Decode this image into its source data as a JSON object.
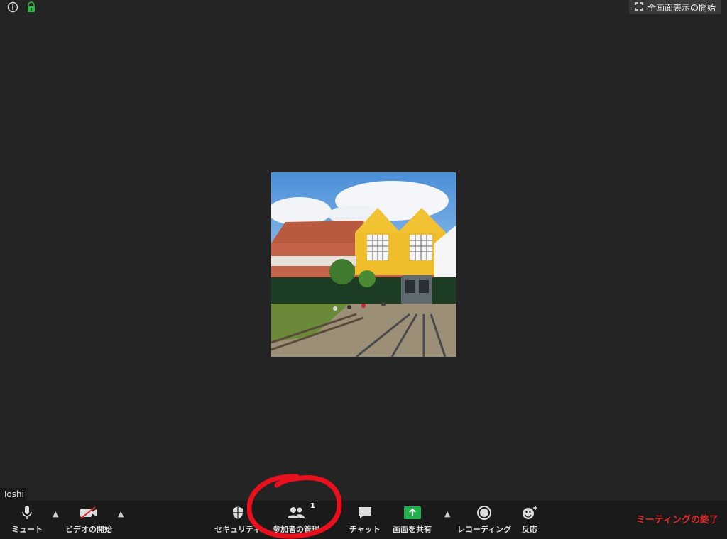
{
  "topbar": {
    "info_icon": "info-icon",
    "security_icon": "shield-lock-icon",
    "fullscreen_label": "全画面表示の開始"
  },
  "participant": {
    "name": "Toshi"
  },
  "toolbar": {
    "mute_label": "ミュート",
    "video_label": "ビデオの開始",
    "security_label": "セキュリティ",
    "participants_label": "参加者の管理",
    "participants_count": "1",
    "chat_label": "チャット",
    "share_label": "画面を共有",
    "record_label": "レコーディング",
    "reactions_label": "反応",
    "end_label": "ミーティングの終了"
  },
  "colors": {
    "background": "#242424",
    "toolbar": "#1a1a1a",
    "share_green": "#22b14c",
    "end_red": "#e02828",
    "annotation_red": "#e8101c"
  }
}
